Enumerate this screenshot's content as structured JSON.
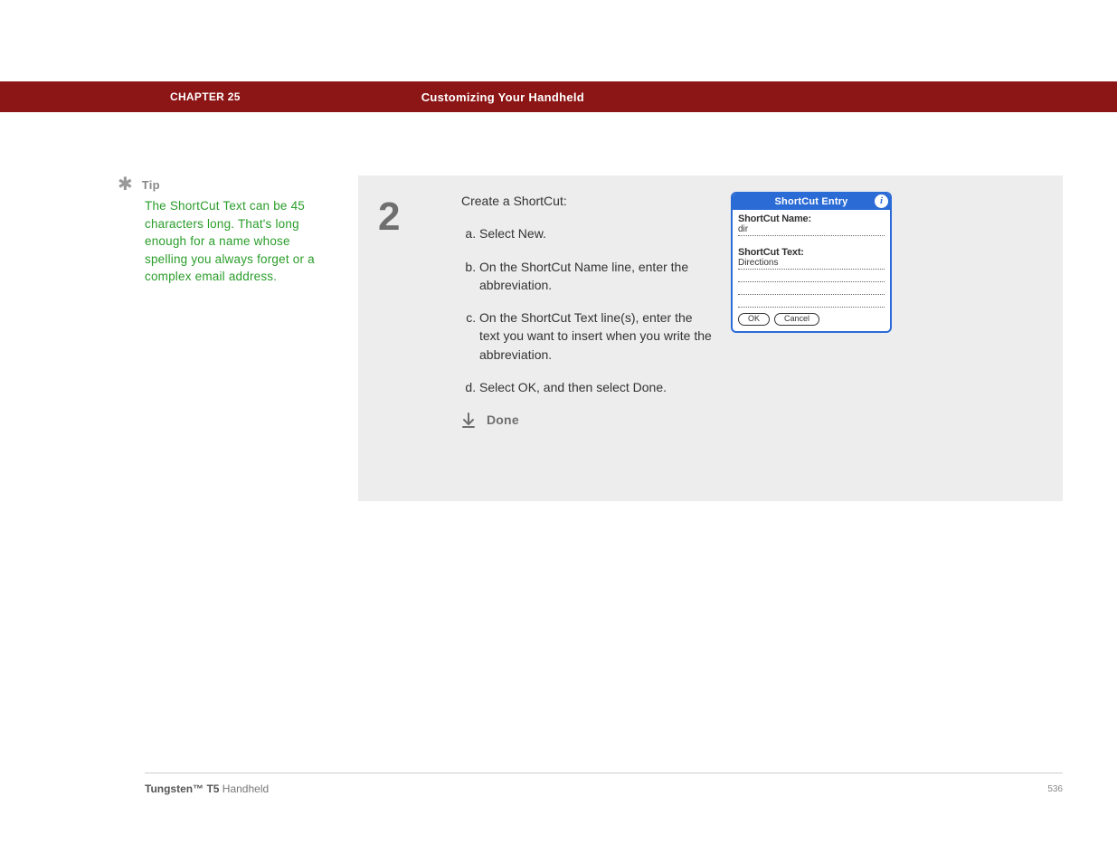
{
  "header": {
    "chapter": "CHAPTER 25",
    "section": "Customizing Your Handheld"
  },
  "tip": {
    "label": "Tip",
    "body": "The ShortCut Text can be 45 characters long. That's long enough for a name whose spelling you always forget or a complex email address."
  },
  "step": {
    "number": "2",
    "intro": "Create a ShortCut:",
    "items": [
      "Select New.",
      "On the ShortCut Name line, enter the abbreviation.",
      "On the ShortCut Text line(s), enter the text you want to insert when you write the abbreviation.",
      "Select OK, and then select Done."
    ],
    "done": "Done"
  },
  "dialog": {
    "title": "ShortCut Entry",
    "info_glyph": "i",
    "label_name": "ShortCut Name:",
    "value_name": "dir",
    "label_text": "ShortCut Text:",
    "value_text": "Directions",
    "ok": "OK",
    "cancel": "Cancel"
  },
  "footer": {
    "product_bold": "Tungsten™ T5",
    "product_rest": " Handheld",
    "page": "536"
  }
}
